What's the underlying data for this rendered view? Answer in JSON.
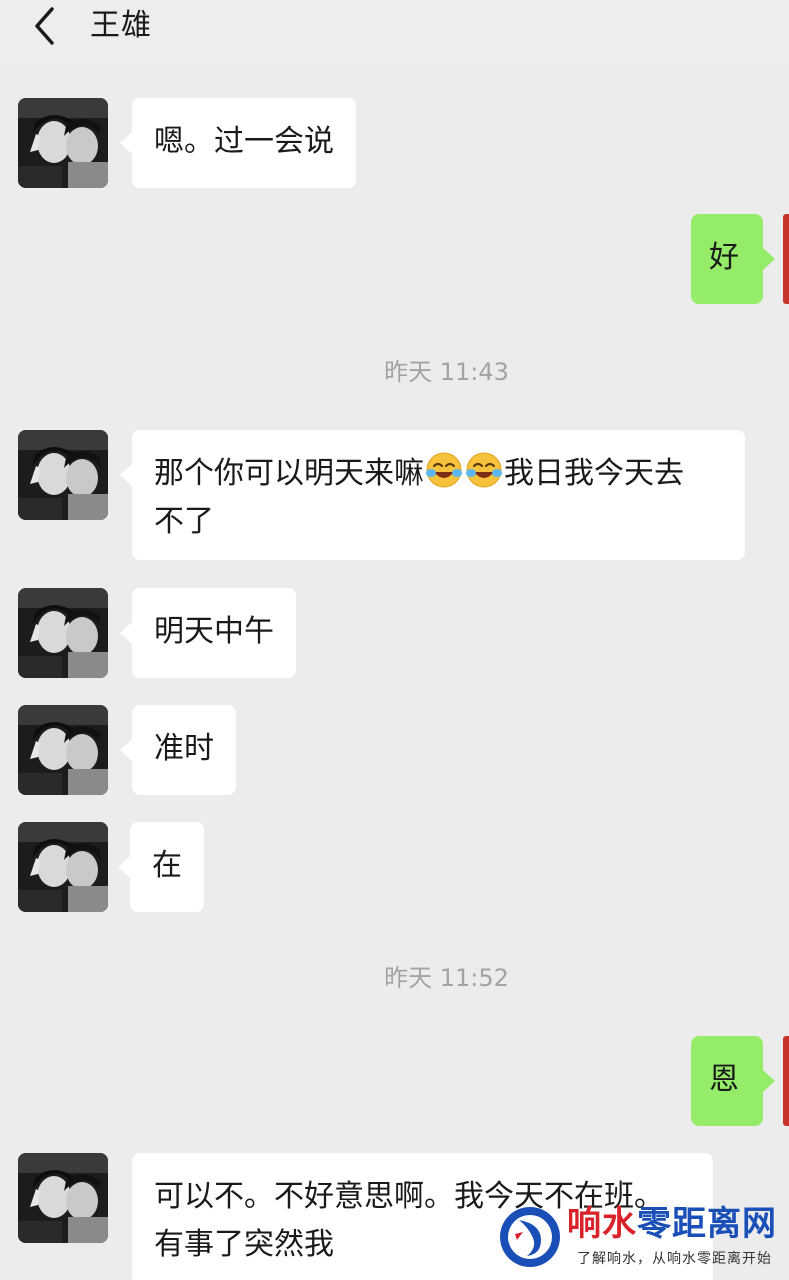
{
  "header": {
    "title": "王雄"
  },
  "messages": [
    {
      "from": "contact",
      "text": "嗯。过一会说"
    },
    {
      "from": "me",
      "text": "好"
    },
    {
      "timestamp": "昨天 11:43"
    },
    {
      "from": "contact",
      "text_a": "那个你可以明天来嘛",
      "text_b": "我日我今天去",
      "text_c": "不了",
      "emoji": "face-with-tears-of-joy"
    },
    {
      "from": "contact",
      "text": "明天中午"
    },
    {
      "from": "contact",
      "text": "准时"
    },
    {
      "from": "contact",
      "text": "在"
    },
    {
      "timestamp": "昨天 11:52"
    },
    {
      "from": "me",
      "text": "恩"
    },
    {
      "from": "contact",
      "text_a": "可以不。不好意思啊。我今天不在班。",
      "text_b": "有事了突然我"
    }
  ],
  "watermark": {
    "title_a": "响水",
    "title_b": "零距离网",
    "slogan": "了解响水，从响水零距离开始"
  },
  "colors": {
    "background": "#ececec",
    "incoming_bubble": "#ffffff",
    "outgoing_bubble": "#95ec69",
    "timestamp_text": "#a3a3a3",
    "watermark_red": "#d8232a",
    "watermark_blue": "#1a4fb8"
  },
  "icons": {
    "back": "chevron-left-icon",
    "avatar": "contact-avatar-photo",
    "emoji": "face-with-tears-of-joy"
  }
}
